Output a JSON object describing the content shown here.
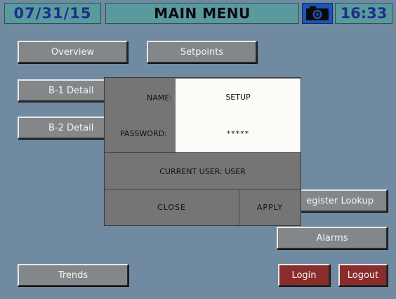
{
  "header": {
    "date": "07/31/15",
    "title": "MAIN MENU",
    "time": "16:33",
    "camera_icon": "camera-icon"
  },
  "buttons": {
    "overview": "Overview",
    "setpoints": "Setpoints",
    "b1_detail": "B-1 Detail",
    "b2_detail": "B-2 Detail",
    "register_lookup": "egister Lookup",
    "alarms": "Alarms",
    "trends": "Trends",
    "login": "Login",
    "logout": "Logout"
  },
  "login_dialog": {
    "name_label": "NAME:",
    "name_value": "SETUP",
    "password_label": "PASSWORD:",
    "password_value": "*****",
    "current_user": "CURRENT USER: USER",
    "close_label": "CLOSE",
    "apply_label": "APPLY"
  },
  "colors": {
    "background": "#6f8aa1",
    "header": "#5a9a9e",
    "camera_button": "#1f54b5",
    "button": "#848789",
    "login_logout_button": "#8a2c2c",
    "dialog": "#757575",
    "field": "#fbfbf8"
  }
}
